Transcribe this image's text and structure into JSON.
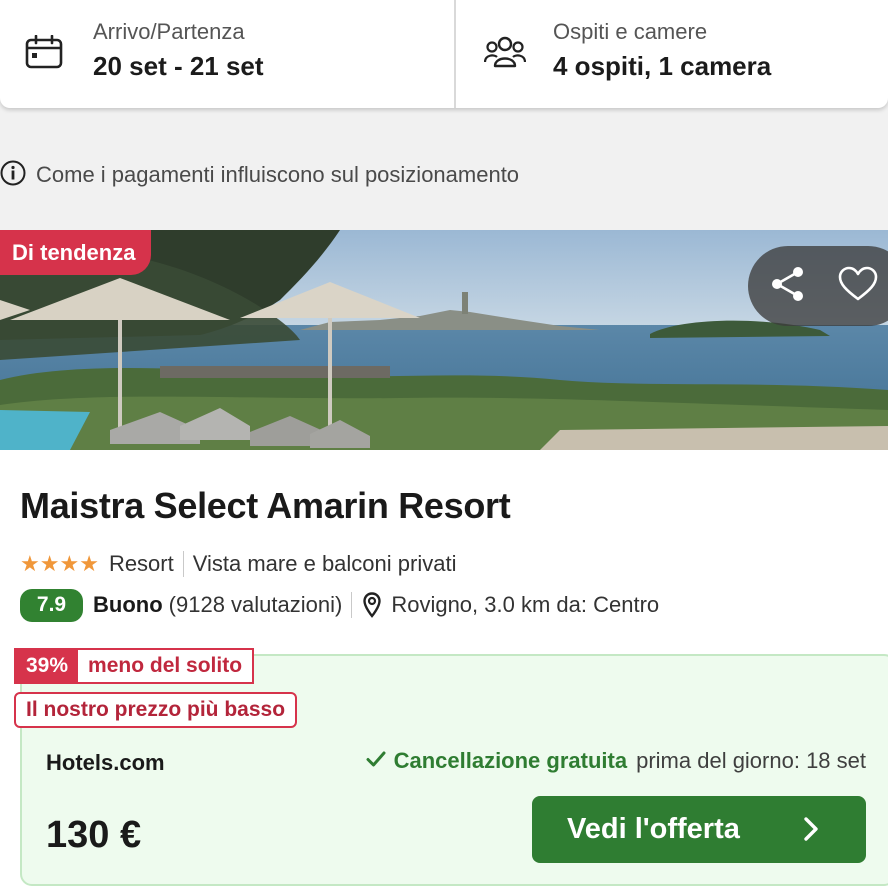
{
  "search": {
    "dates_label": "Arrivo/Partenza",
    "dates_value": "20 set - 21 set",
    "guests_label": "Ospiti e camere",
    "guests_value": "4 ospiti, 1 camera"
  },
  "info_text": "Come i pagamenti influiscono sul posizionamento",
  "listing": {
    "badge": "Di tendenza",
    "name": "Maistra Select Amarin Resort",
    "star_count": 4,
    "type": "Resort",
    "feature": "Vista mare e balconi privati",
    "rating": "7.9",
    "rating_word": "Buono",
    "reviews": "(9128 valutazioni)",
    "location": "Rovigno, 3.0 km da: Centro",
    "discount_pct": "39%",
    "discount_text": "meno del solito",
    "lowest_price_label": "Il nostro prezzo più basso",
    "provider": "Hotels.com",
    "cancel_strong": "Cancellazione gratuita",
    "cancel_date": "prima del giorno: 18 set",
    "price": "130 €",
    "cta_label": "Vedi l'offerta"
  },
  "colors": {
    "accent_green": "#2f7d32",
    "badge_red": "#d6334b",
    "rating_green": "#318231",
    "star_orange": "#f0973a",
    "deal_bg": "#eefbee"
  },
  "icons": [
    "calendar-icon",
    "guests-icon",
    "info-icon",
    "share-icon",
    "heart-icon",
    "star-icon",
    "map-pin-icon",
    "check-icon",
    "chevron-right-icon"
  ]
}
